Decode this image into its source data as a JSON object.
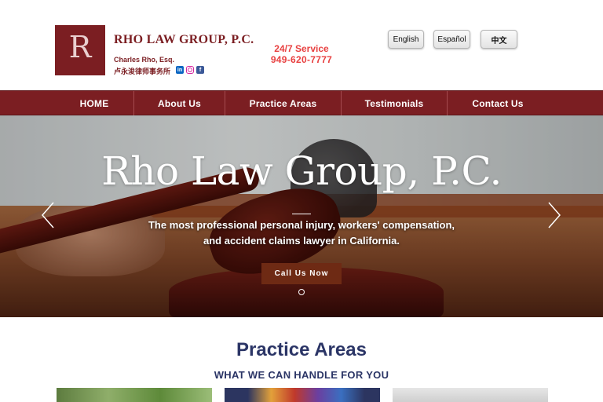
{
  "header": {
    "logo_letter": "R",
    "firm_name": "RHO LAW GROUP, P.C.",
    "attorney": "Charles Rho, Esq.",
    "chinese_name": "卢永浚律师事务所",
    "social_icons": [
      "linkedin-icon",
      "instagram-icon",
      "facebook-icon"
    ],
    "service_label": "24/7 Service",
    "phone": "949-620-7777",
    "languages": [
      "English",
      "Español",
      "中文"
    ]
  },
  "nav": {
    "items": [
      "HOME",
      "About Us",
      "Practice Areas",
      "Testimonials",
      "Contact Us"
    ]
  },
  "hero": {
    "title": "Rho Law Group, P.C.",
    "subtitle": "The most professional personal injury, workers' compensation, and accident claims lawyer in California.",
    "cta": "Call Us Now"
  },
  "practice": {
    "title": "Practice Areas",
    "subtitle": "WHAT WE CAN HANDLE FOR YOU"
  },
  "colors": {
    "brand": "#7b1e22",
    "accent_red": "#e84040",
    "heading_navy": "#2b3566",
    "cta_brown": "#6e2a14"
  }
}
